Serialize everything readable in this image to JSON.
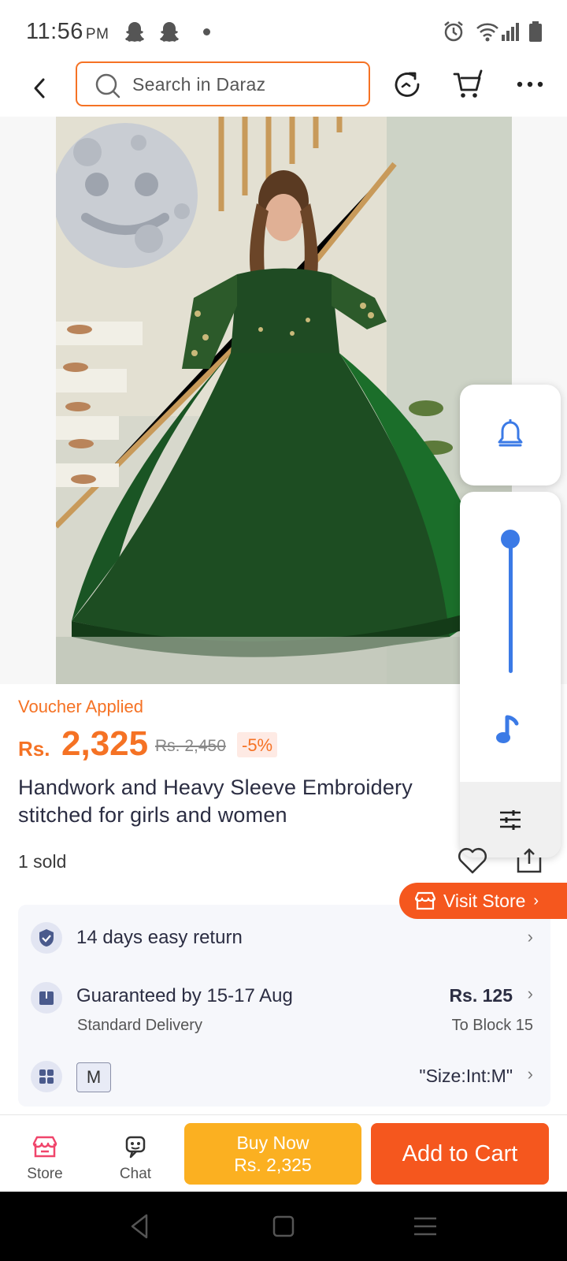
{
  "status_bar": {
    "time": "11:56",
    "ampm": "PM",
    "icons": [
      "snapchat-ghost-icon",
      "snapchat-ghost-icon",
      "dot-icon",
      "alarm-icon",
      "wifi-icon",
      "signal-icon",
      "battery-icon"
    ]
  },
  "top_nav": {
    "search_placeholder": "Search in Daraz",
    "icons": [
      "back-icon",
      "search-icon",
      "history-icon",
      "cart-icon",
      "more-icon"
    ]
  },
  "floating_widget": {
    "accent_color": "#3b7ae6",
    "volume_level": 1.0,
    "icons": [
      "bell-icon",
      "music-note-icon",
      "equalizer-icon"
    ]
  },
  "product": {
    "voucher_label": "Voucher Applied",
    "currency": "Rs.",
    "price": "2,325",
    "old_price": "Rs. 2,450",
    "discount": "-5%",
    "title": "Handwork and Heavy Sleeve Embroidery stitched for girls and women",
    "sold": "1 sold",
    "visit_store": "Visit Store",
    "accent_color": "#f57224"
  },
  "services": {
    "return": "14 days easy return",
    "delivery_title": "Guaranteed by 15-17 Aug",
    "delivery_sub": "Standard Delivery",
    "delivery_price": "Rs. 125",
    "delivery_location": "To Block 15",
    "size_chip": "M",
    "size_value": "\"Size:Int:M\""
  },
  "bottom_bar": {
    "store_label": "Store",
    "chat_label": "Chat",
    "buy_now_label": "Buy Now",
    "buy_now_price": "Rs. 2,325",
    "add_to_cart_label": "Add to Cart"
  }
}
